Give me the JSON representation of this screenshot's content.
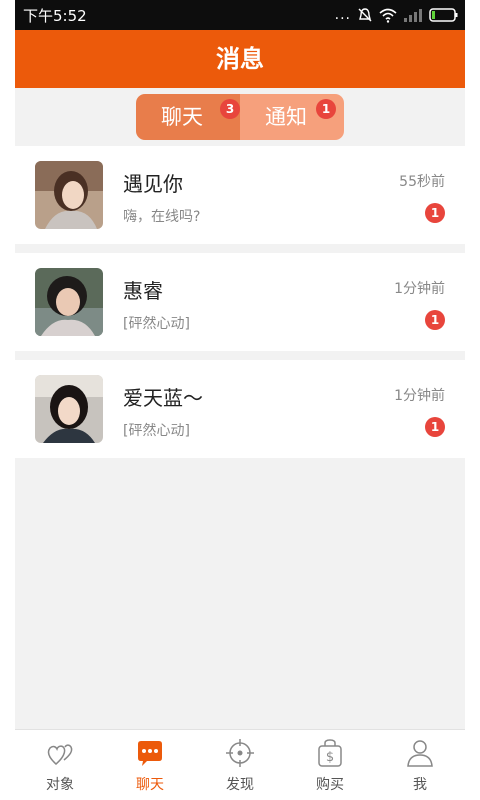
{
  "status_bar": {
    "time": "下午5:52",
    "dots": "..."
  },
  "header": {
    "title": "消息"
  },
  "tabs": [
    {
      "label": "聊天",
      "badge": "3"
    },
    {
      "label": "通知",
      "badge": "1"
    }
  ],
  "conversations": [
    {
      "name": "遇见你",
      "message": "嗨，在线吗?",
      "time": "55秒前",
      "badge": "1"
    },
    {
      "name": "惠睿",
      "message": "[砰然心动]",
      "time": "1分钟前",
      "badge": "1"
    },
    {
      "name": "爱天蓝～",
      "message": "[砰然心动]",
      "time": "1分钟前",
      "badge": "1"
    }
  ],
  "bottom_nav": [
    {
      "label": "对象",
      "icon": "hearts-icon"
    },
    {
      "label": "聊天",
      "icon": "chat-bubble-icon"
    },
    {
      "label": "发现",
      "icon": "crosshair-icon"
    },
    {
      "label": "购买",
      "icon": "dollar-bag-icon"
    },
    {
      "label": "我",
      "icon": "person-icon"
    }
  ],
  "colors": {
    "brand": "#ec5a0b",
    "badge": "#e8453c",
    "tab_active": "#e87d4b",
    "tab_inactive": "#f6a07c"
  }
}
